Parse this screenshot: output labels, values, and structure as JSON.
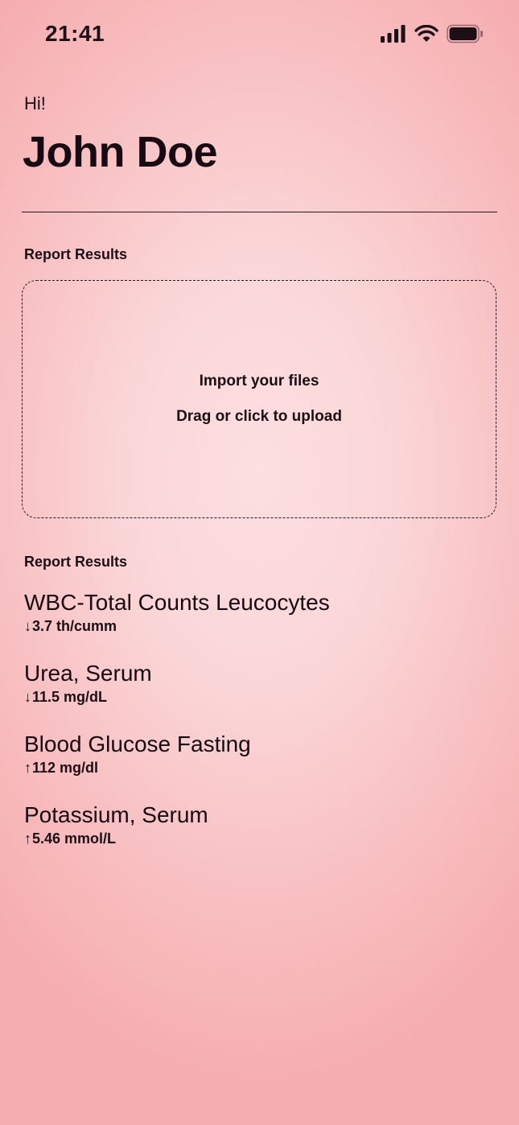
{
  "status_bar": {
    "time": "21:41"
  },
  "header": {
    "greeting": "Hi!",
    "name": "John Doe"
  },
  "upload_section": {
    "label": "Report Results",
    "title": "Import your files",
    "subtitle": "Drag or click to upload"
  },
  "results_section": {
    "label": "Report Results",
    "items": [
      {
        "name": "WBC-Total Counts Leucocytes",
        "direction": "down",
        "arrow": "↓",
        "value": "3.7 th/cumm"
      },
      {
        "name": "Urea, Serum",
        "direction": "down",
        "arrow": "↓",
        "value": "11.5 mg/dL"
      },
      {
        "name": "Blood Glucose Fasting",
        "direction": "up",
        "arrow": "↑",
        "value": "112 mg/dl"
      },
      {
        "name": "Potassium, Serum",
        "direction": "up",
        "arrow": "↑",
        "value": "5.46 mmol/L"
      }
    ]
  },
  "icons": [
    "cellular-signal-icon",
    "wifi-icon",
    "battery-icon",
    "arrow-down-icon",
    "arrow-up-icon"
  ],
  "colors": {
    "text": "#1c0f16",
    "background_center": "#fcdfe1",
    "background_edge": "#f6adb0"
  }
}
